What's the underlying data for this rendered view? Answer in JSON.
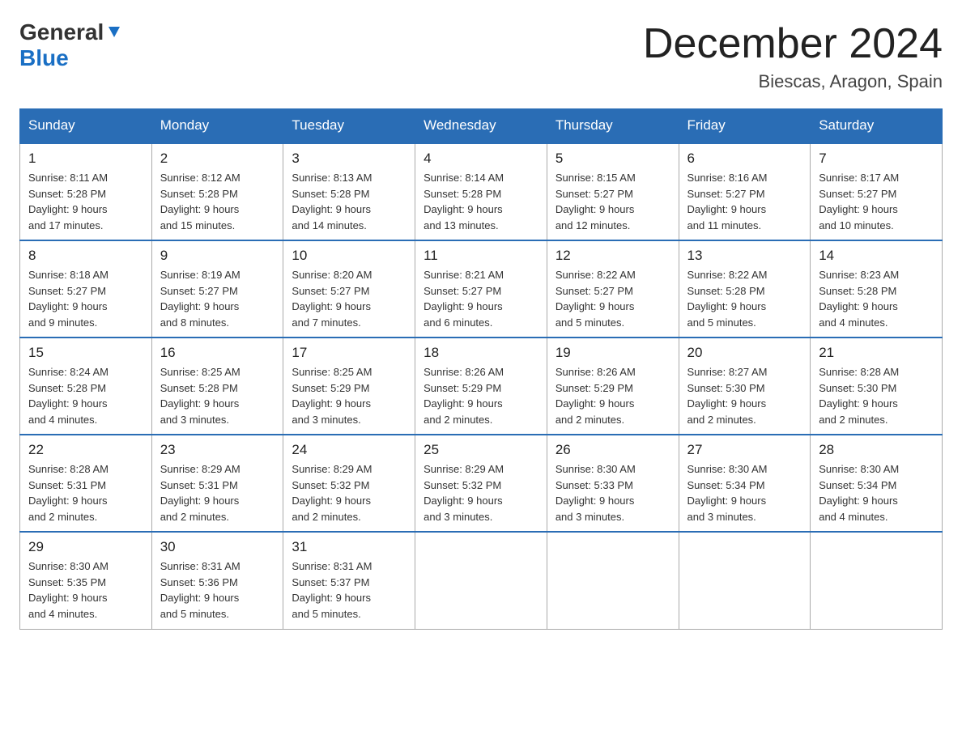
{
  "logo": {
    "general": "General",
    "blue": "Blue"
  },
  "title": "December 2024",
  "location": "Biescas, Aragon, Spain",
  "days_of_week": [
    "Sunday",
    "Monday",
    "Tuesday",
    "Wednesday",
    "Thursday",
    "Friday",
    "Saturday"
  ],
  "weeks": [
    [
      {
        "day": "1",
        "sunrise": "8:11 AM",
        "sunset": "5:28 PM",
        "daylight": "9 hours and 17 minutes."
      },
      {
        "day": "2",
        "sunrise": "8:12 AM",
        "sunset": "5:28 PM",
        "daylight": "9 hours and 15 minutes."
      },
      {
        "day": "3",
        "sunrise": "8:13 AM",
        "sunset": "5:28 PM",
        "daylight": "9 hours and 14 minutes."
      },
      {
        "day": "4",
        "sunrise": "8:14 AM",
        "sunset": "5:28 PM",
        "daylight": "9 hours and 13 minutes."
      },
      {
        "day": "5",
        "sunrise": "8:15 AM",
        "sunset": "5:27 PM",
        "daylight": "9 hours and 12 minutes."
      },
      {
        "day": "6",
        "sunrise": "8:16 AM",
        "sunset": "5:27 PM",
        "daylight": "9 hours and 11 minutes."
      },
      {
        "day": "7",
        "sunrise": "8:17 AM",
        "sunset": "5:27 PM",
        "daylight": "9 hours and 10 minutes."
      }
    ],
    [
      {
        "day": "8",
        "sunrise": "8:18 AM",
        "sunset": "5:27 PM",
        "daylight": "9 hours and 9 minutes."
      },
      {
        "day": "9",
        "sunrise": "8:19 AM",
        "sunset": "5:27 PM",
        "daylight": "9 hours and 8 minutes."
      },
      {
        "day": "10",
        "sunrise": "8:20 AM",
        "sunset": "5:27 PM",
        "daylight": "9 hours and 7 minutes."
      },
      {
        "day": "11",
        "sunrise": "8:21 AM",
        "sunset": "5:27 PM",
        "daylight": "9 hours and 6 minutes."
      },
      {
        "day": "12",
        "sunrise": "8:22 AM",
        "sunset": "5:27 PM",
        "daylight": "9 hours and 5 minutes."
      },
      {
        "day": "13",
        "sunrise": "8:22 AM",
        "sunset": "5:28 PM",
        "daylight": "9 hours and 5 minutes."
      },
      {
        "day": "14",
        "sunrise": "8:23 AM",
        "sunset": "5:28 PM",
        "daylight": "9 hours and 4 minutes."
      }
    ],
    [
      {
        "day": "15",
        "sunrise": "8:24 AM",
        "sunset": "5:28 PM",
        "daylight": "9 hours and 4 minutes."
      },
      {
        "day": "16",
        "sunrise": "8:25 AM",
        "sunset": "5:28 PM",
        "daylight": "9 hours and 3 minutes."
      },
      {
        "day": "17",
        "sunrise": "8:25 AM",
        "sunset": "5:29 PM",
        "daylight": "9 hours and 3 minutes."
      },
      {
        "day": "18",
        "sunrise": "8:26 AM",
        "sunset": "5:29 PM",
        "daylight": "9 hours and 2 minutes."
      },
      {
        "day": "19",
        "sunrise": "8:26 AM",
        "sunset": "5:29 PM",
        "daylight": "9 hours and 2 minutes."
      },
      {
        "day": "20",
        "sunrise": "8:27 AM",
        "sunset": "5:30 PM",
        "daylight": "9 hours and 2 minutes."
      },
      {
        "day": "21",
        "sunrise": "8:28 AM",
        "sunset": "5:30 PM",
        "daylight": "9 hours and 2 minutes."
      }
    ],
    [
      {
        "day": "22",
        "sunrise": "8:28 AM",
        "sunset": "5:31 PM",
        "daylight": "9 hours and 2 minutes."
      },
      {
        "day": "23",
        "sunrise": "8:29 AM",
        "sunset": "5:31 PM",
        "daylight": "9 hours and 2 minutes."
      },
      {
        "day": "24",
        "sunrise": "8:29 AM",
        "sunset": "5:32 PM",
        "daylight": "9 hours and 2 minutes."
      },
      {
        "day": "25",
        "sunrise": "8:29 AM",
        "sunset": "5:32 PM",
        "daylight": "9 hours and 3 minutes."
      },
      {
        "day": "26",
        "sunrise": "8:30 AM",
        "sunset": "5:33 PM",
        "daylight": "9 hours and 3 minutes."
      },
      {
        "day": "27",
        "sunrise": "8:30 AM",
        "sunset": "5:34 PM",
        "daylight": "9 hours and 3 minutes."
      },
      {
        "day": "28",
        "sunrise": "8:30 AM",
        "sunset": "5:34 PM",
        "daylight": "9 hours and 4 minutes."
      }
    ],
    [
      {
        "day": "29",
        "sunrise": "8:30 AM",
        "sunset": "5:35 PM",
        "daylight": "9 hours and 4 minutes."
      },
      {
        "day": "30",
        "sunrise": "8:31 AM",
        "sunset": "5:36 PM",
        "daylight": "9 hours and 5 minutes."
      },
      {
        "day": "31",
        "sunrise": "8:31 AM",
        "sunset": "5:37 PM",
        "daylight": "9 hours and 5 minutes."
      },
      null,
      null,
      null,
      null
    ]
  ]
}
